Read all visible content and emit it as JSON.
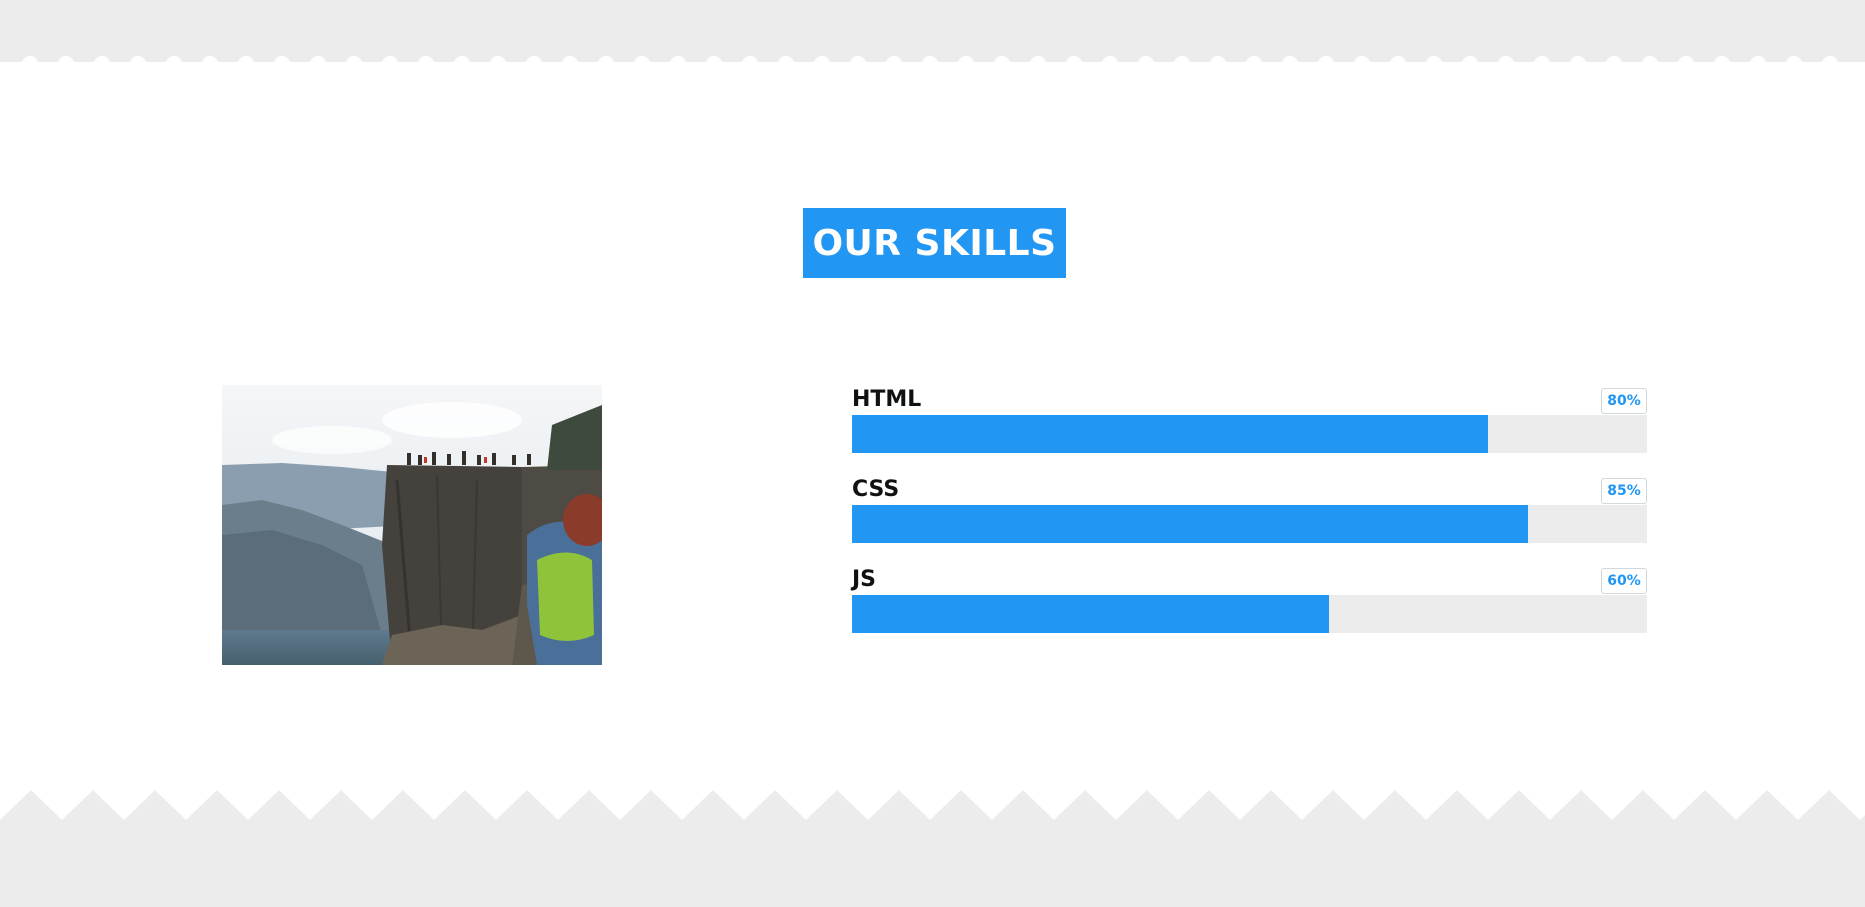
{
  "section": {
    "title": "OUR SKILLS"
  },
  "photo": {
    "alt": "cliff photo"
  },
  "skills": [
    {
      "label": "HTML",
      "percent_label": "80%",
      "percent": 80
    },
    {
      "label": "CSS",
      "percent_label": "85%",
      "percent": 85
    },
    {
      "label": "JS",
      "percent_label": "60%",
      "percent": 60
    }
  ],
  "colors": {
    "accent": "#2196f3",
    "band": "#ececec",
    "track": "#ececec"
  }
}
